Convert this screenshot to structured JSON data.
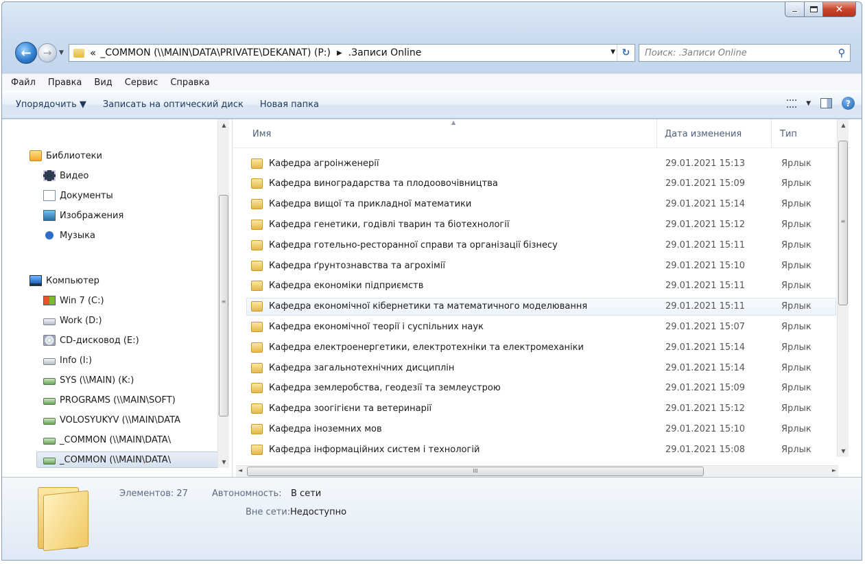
{
  "address": {
    "overflow_chevron": "«",
    "path_segments": [
      "_COMMON (\\\\MAIN\\DATA\\PRIVATE\\DEKANAT) (P:)",
      ".Записи Online"
    ]
  },
  "search": {
    "placeholder": "Поиск: .Записи Online"
  },
  "menu": [
    "Файл",
    "Правка",
    "Вид",
    "Сервис",
    "Справка"
  ],
  "toolbar": {
    "organize": "Упорядочить ▼",
    "burn": "Записать на оптический диск",
    "new_folder": "Новая папка"
  },
  "sidebar": {
    "libraries": {
      "label": "Библиотеки",
      "items": [
        "Видео",
        "Документы",
        "Изображения",
        "Музыка"
      ]
    },
    "computer": {
      "label": "Компьютер",
      "items": [
        "Win 7 (C:)",
        "Work (D:)",
        "CD-дисковод (E:)",
        "Info (I:)",
        "SYS (\\\\MAIN) (K:)",
        "PROGRAMS (\\\\MAIN\\SOFT)",
        "VOLOSYUKYV (\\\\MAIN\\DATA",
        "_COMMON (\\\\MAIN\\DATA\\",
        "_COMMON (\\\\MAIN\\DATA\\"
      ]
    }
  },
  "columns": {
    "name": "Имя",
    "date": "Дата изменения",
    "type": "Тип"
  },
  "files": [
    {
      "name": "Кафедра агроінженерії",
      "date": "29.01.2021 15:13",
      "type": "Ярлык"
    },
    {
      "name": "Кафедра виноградарства та плодоовочівництва",
      "date": "29.01.2021 15:09",
      "type": "Ярлык"
    },
    {
      "name": "Кафедра вищої та прикладної математики",
      "date": "29.01.2021 15:14",
      "type": "Ярлык"
    },
    {
      "name": "Кафедра генетики, годівлі тварин та біотехнології",
      "date": "29.01.2021 15:12",
      "type": "Ярлык"
    },
    {
      "name": "Кафедра готельно-ресторанної справи та організації бізнесу",
      "date": "29.01.2021 15:11",
      "type": "Ярлык"
    },
    {
      "name": "Кафедра ґрунтознавства та агрохімії",
      "date": "29.01.2021 15:10",
      "type": "Ярлык"
    },
    {
      "name": "Кафедра економіки підприємств",
      "date": "29.01.2021 15:11",
      "type": "Ярлык"
    },
    {
      "name": "Кафедра економічної кібернетики та математичного моделювання",
      "date": "29.01.2021 15:11",
      "type": "Ярлык"
    },
    {
      "name": "Кафедра економічної теорії і суспільних наук",
      "date": "29.01.2021 15:07",
      "type": "Ярлык"
    },
    {
      "name": "Кафедра електроенергетики, електротехніки та електромеханіки",
      "date": "29.01.2021 15:14",
      "type": "Ярлык"
    },
    {
      "name": "Кафедра загальнотехнічних дисциплін",
      "date": "29.01.2021 15:14",
      "type": "Ярлык"
    },
    {
      "name": "Кафедра землеробства, геодезії та землеустрою",
      "date": "29.01.2021 15:09",
      "type": "Ярлык"
    },
    {
      "name": "Кафедра зоогігієни та ветеринарії",
      "date": "29.01.2021 15:12",
      "type": "Ярлык"
    },
    {
      "name": "Кафедра іноземних мов",
      "date": "29.01.2021 15:10",
      "type": "Ярлык"
    },
    {
      "name": "Кафедра інформаційних систем і технологій",
      "date": "29.01.2021 15:08",
      "type": "Ярлык"
    }
  ],
  "details": {
    "items_label": "Элементов: 27",
    "offline_label": "Автономность:",
    "offline_value": "В сети",
    "offline_avail_label": "Вне сети:",
    "offline_avail_value": "Недоступно"
  },
  "scroll_glyphs": {
    "up": "▲",
    "down": "▼",
    "left": "◄",
    "right": "►",
    "grip": "≡",
    "hgrip": "III"
  }
}
